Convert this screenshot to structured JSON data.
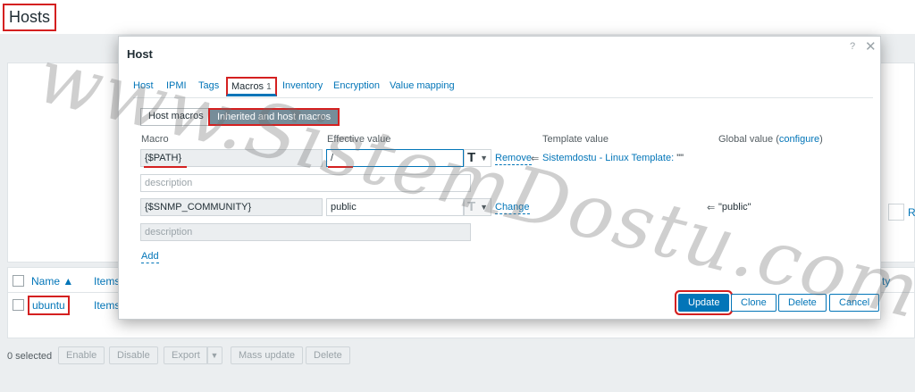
{
  "page": {
    "title": "Hosts",
    "table": {
      "col_name": "Name ▲",
      "col_items": "Items",
      "col_right": "ty",
      "row_name": "ubuntu",
      "row_items": "Items"
    },
    "filter_link": "Re",
    "bottom": {
      "selected": "0 selected",
      "buttons": [
        "Enable",
        "Disable",
        "Export",
        "Mass update",
        "Delete"
      ]
    }
  },
  "dialog": {
    "title": "Host",
    "help": "?",
    "close": "✕",
    "tabs": {
      "host": "Host",
      "ipmi": "IPMI",
      "tags": "Tags",
      "macros": "Macros",
      "macros_count": "1",
      "inventory": "Inventory",
      "encryption": "Encryption",
      "value_mapping": "Value mapping"
    },
    "segments": {
      "host_macros": "Host macros",
      "inherited": "Inherited and host macros"
    },
    "columns": {
      "macro": "Macro",
      "effective_value": "Effective value",
      "template_value": "Template value",
      "global_value": "Global value (",
      "configure": "configure",
      "global_close": ")"
    },
    "rows": [
      {
        "macro": "{$PATH}",
        "value": "/",
        "description_placeholder": "description",
        "action": "Remove",
        "arrow": "⇐",
        "template_link": "Sistemdostu - Linux Template:",
        "template_value": " \"\""
      },
      {
        "macro": "{$SNMP_COMMUNITY}",
        "value": "public",
        "description_placeholder": "description",
        "action": "Change",
        "global_arrow": "⇐",
        "global_value": "\"public\""
      }
    ],
    "type_glyph": "T",
    "type_chevron": "⌵",
    "add": "Add",
    "footer": {
      "update": "Update",
      "clone": "Clone",
      "delete": "Delete",
      "cancel": "Cancel"
    }
  },
  "watermark": "www.SistemDostu.com",
  "colors": {
    "accent": "#0275b8",
    "highlight_border": "#d42020",
    "segment_active": "#768d99"
  }
}
